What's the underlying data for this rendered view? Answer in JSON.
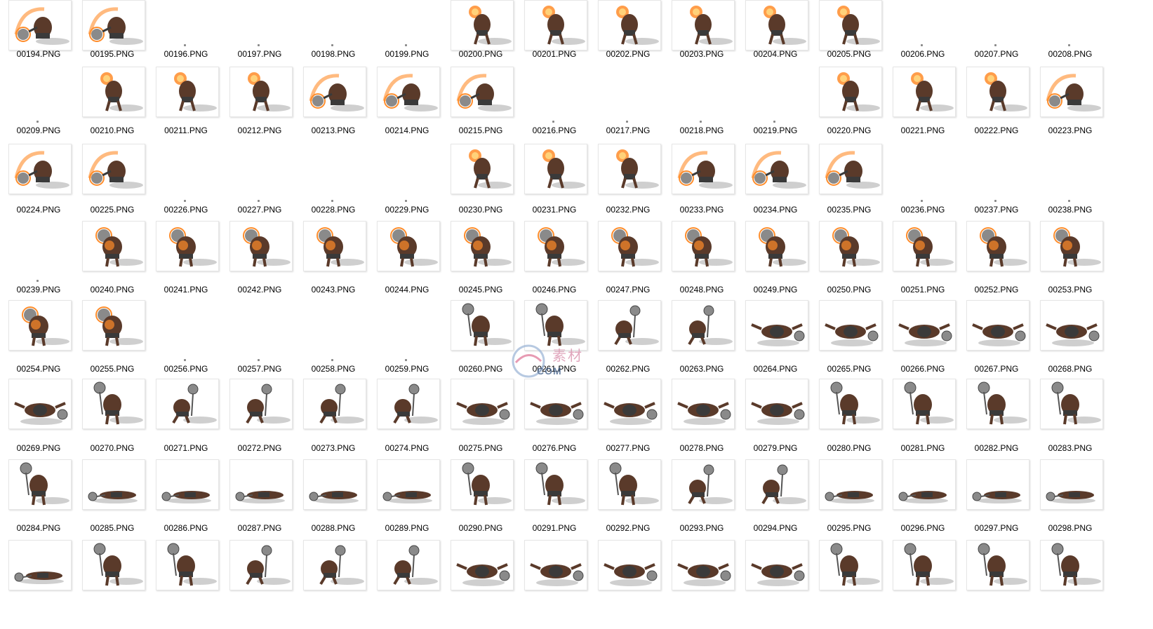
{
  "explorer": {
    "view": "large-icons",
    "columns": 15,
    "rows": [
      {
        "files": [
          {
            "name": "00194.PNG",
            "sprite": "fire-mace-swing"
          },
          {
            "name": "00195.PNG",
            "sprite": "fire-mace-swing"
          },
          {
            "name": "00196.PNG",
            "sprite": "empty"
          },
          {
            "name": "00197.PNG",
            "sprite": "empty"
          },
          {
            "name": "00198.PNG",
            "sprite": "empty"
          },
          {
            "name": "00199.PNG",
            "sprite": "empty"
          },
          {
            "name": "00200.PNG",
            "sprite": "fire-mace-raise"
          },
          {
            "name": "00201.PNG",
            "sprite": "fire-mace-raise"
          },
          {
            "name": "00202.PNG",
            "sprite": "fire-mace-raise"
          },
          {
            "name": "00203.PNG",
            "sprite": "fire-mace-raise"
          },
          {
            "name": "00204.PNG",
            "sprite": "fire-mace-raise"
          },
          {
            "name": "00205.PNG",
            "sprite": "fire-mace-raise"
          },
          {
            "name": "00206.PNG",
            "sprite": "empty"
          },
          {
            "name": "00207.PNG",
            "sprite": "empty"
          },
          {
            "name": "00208.PNG",
            "sprite": "empty"
          }
        ]
      },
      {
        "files": [
          {
            "name": "00209.PNG",
            "sprite": "empty"
          },
          {
            "name": "00210.PNG",
            "sprite": "fire-mace-raise"
          },
          {
            "name": "00211.PNG",
            "sprite": "fire-mace-raise"
          },
          {
            "name": "00212.PNG",
            "sprite": "fire-mace-raise"
          },
          {
            "name": "00213.PNG",
            "sprite": "fire-mace-swing"
          },
          {
            "name": "00214.PNG",
            "sprite": "fire-mace-swing"
          },
          {
            "name": "00215.PNG",
            "sprite": "fire-mace-swing"
          },
          {
            "name": "00216.PNG",
            "sprite": "empty"
          },
          {
            "name": "00217.PNG",
            "sprite": "empty"
          },
          {
            "name": "00218.PNG",
            "sprite": "empty"
          },
          {
            "name": "00219.PNG",
            "sprite": "empty"
          },
          {
            "name": "00220.PNG",
            "sprite": "fire-mace-raise"
          },
          {
            "name": "00221.PNG",
            "sprite": "fire-mace-raise"
          },
          {
            "name": "00222.PNG",
            "sprite": "fire-mace-raise"
          },
          {
            "name": "00223.PNG",
            "sprite": "fire-mace-swing"
          }
        ]
      },
      {
        "files": [
          {
            "name": "00224.PNG",
            "sprite": "fire-mace-swing"
          },
          {
            "name": "00225.PNG",
            "sprite": "fire-mace-swing"
          },
          {
            "name": "00226.PNG",
            "sprite": "empty"
          },
          {
            "name": "00227.PNG",
            "sprite": "empty"
          },
          {
            "name": "00228.PNG",
            "sprite": "empty"
          },
          {
            "name": "00229.PNG",
            "sprite": "empty"
          },
          {
            "name": "00230.PNG",
            "sprite": "fire-mace-raise"
          },
          {
            "name": "00231.PNG",
            "sprite": "fire-mace-raise"
          },
          {
            "name": "00232.PNG",
            "sprite": "fire-mace-raise"
          },
          {
            "name": "00233.PNG",
            "sprite": "fire-mace-swing"
          },
          {
            "name": "00234.PNG",
            "sprite": "fire-mace-swing"
          },
          {
            "name": "00235.PNG",
            "sprite": "fire-mace-swing"
          },
          {
            "name": "00236.PNG",
            "sprite": "empty"
          },
          {
            "name": "00237.PNG",
            "sprite": "empty"
          },
          {
            "name": "00238.PNG",
            "sprite": "empty"
          }
        ]
      },
      {
        "files": [
          {
            "name": "00239.PNG",
            "sprite": "empty"
          },
          {
            "name": "00240.PNG",
            "sprite": "fire-mace-hold"
          },
          {
            "name": "00241.PNG",
            "sprite": "fire-mace-hold"
          },
          {
            "name": "00242.PNG",
            "sprite": "fire-mace-hold"
          },
          {
            "name": "00243.PNG",
            "sprite": "fire-mace-hold"
          },
          {
            "name": "00244.PNG",
            "sprite": "fire-mace-hold"
          },
          {
            "name": "00245.PNG",
            "sprite": "fire-mace-hold"
          },
          {
            "name": "00246.PNG",
            "sprite": "fire-mace-hold"
          },
          {
            "name": "00247.PNG",
            "sprite": "fire-mace-hold"
          },
          {
            "name": "00248.PNG",
            "sprite": "fire-mace-hold"
          },
          {
            "name": "00249.PNG",
            "sprite": "fire-mace-hold"
          },
          {
            "name": "00250.PNG",
            "sprite": "fire-mace-hold"
          },
          {
            "name": "00251.PNG",
            "sprite": "fire-mace-hold"
          },
          {
            "name": "00252.PNG",
            "sprite": "fire-mace-hold"
          },
          {
            "name": "00253.PNG",
            "sprite": "fire-mace-hold"
          }
        ]
      },
      {
        "files": [
          {
            "name": "00254.PNG",
            "sprite": "fire-mace-hold"
          },
          {
            "name": "00255.PNG",
            "sprite": "fire-mace-hold"
          },
          {
            "name": "00256.PNG",
            "sprite": "empty"
          },
          {
            "name": "00257.PNG",
            "sprite": "empty"
          },
          {
            "name": "00258.PNG",
            "sprite": "empty"
          },
          {
            "name": "00259.PNG",
            "sprite": "empty"
          },
          {
            "name": "00260.PNG",
            "sprite": "mace-stand"
          },
          {
            "name": "00261.PNG",
            "sprite": "mace-stand"
          },
          {
            "name": "00262.PNG",
            "sprite": "mace-walk"
          },
          {
            "name": "00263.PNG",
            "sprite": "mace-walk"
          },
          {
            "name": "00264.PNG",
            "sprite": "mace-fall"
          },
          {
            "name": "00265.PNG",
            "sprite": "mace-fall"
          },
          {
            "name": "00266.PNG",
            "sprite": "mace-fall"
          },
          {
            "name": "00267.PNG",
            "sprite": "mace-fall"
          },
          {
            "name": "00268.PNG",
            "sprite": "mace-fall"
          }
        ]
      },
      {
        "files": [
          {
            "name": "00269.PNG",
            "sprite": "mace-fall"
          },
          {
            "name": "00270.PNG",
            "sprite": "mace-stand"
          },
          {
            "name": "00271.PNG",
            "sprite": "mace-walk"
          },
          {
            "name": "00272.PNG",
            "sprite": "mace-walk"
          },
          {
            "name": "00273.PNG",
            "sprite": "mace-walk"
          },
          {
            "name": "00274.PNG",
            "sprite": "mace-walk"
          },
          {
            "name": "00275.PNG",
            "sprite": "mace-fall"
          },
          {
            "name": "00276.PNG",
            "sprite": "mace-fall"
          },
          {
            "name": "00277.PNG",
            "sprite": "mace-fall"
          },
          {
            "name": "00278.PNG",
            "sprite": "mace-fall"
          },
          {
            "name": "00279.PNG",
            "sprite": "mace-fall"
          },
          {
            "name": "00280.PNG",
            "sprite": "mace-stand"
          },
          {
            "name": "00281.PNG",
            "sprite": "mace-stand"
          },
          {
            "name": "00282.PNG",
            "sprite": "mace-stand"
          },
          {
            "name": "00283.PNG",
            "sprite": "mace-stand"
          }
        ]
      },
      {
        "files": [
          {
            "name": "00284.PNG",
            "sprite": "mace-stand"
          },
          {
            "name": "00285.PNG",
            "sprite": "mace-lying"
          },
          {
            "name": "00286.PNG",
            "sprite": "mace-lying"
          },
          {
            "name": "00287.PNG",
            "sprite": "mace-lying"
          },
          {
            "name": "00288.PNG",
            "sprite": "mace-lying"
          },
          {
            "name": "00289.PNG",
            "sprite": "mace-lying"
          },
          {
            "name": "00290.PNG",
            "sprite": "mace-stand"
          },
          {
            "name": "00291.PNG",
            "sprite": "mace-stand"
          },
          {
            "name": "00292.PNG",
            "sprite": "mace-stand"
          },
          {
            "name": "00293.PNG",
            "sprite": "mace-walk"
          },
          {
            "name": "00294.PNG",
            "sprite": "mace-walk"
          },
          {
            "name": "00295.PNG",
            "sprite": "mace-lying"
          },
          {
            "name": "00296.PNG",
            "sprite": "mace-lying"
          },
          {
            "name": "00297.PNG",
            "sprite": "mace-lying"
          },
          {
            "name": "00298.PNG",
            "sprite": "mace-lying"
          }
        ]
      },
      {
        "files": [
          {
            "name": "",
            "sprite": "mace-lying"
          },
          {
            "name": "",
            "sprite": "mace-stand"
          },
          {
            "name": "",
            "sprite": "mace-stand"
          },
          {
            "name": "",
            "sprite": "mace-walk"
          },
          {
            "name": "",
            "sprite": "mace-walk"
          },
          {
            "name": "",
            "sprite": "mace-walk"
          },
          {
            "name": "",
            "sprite": "mace-fall"
          },
          {
            "name": "",
            "sprite": "mace-fall"
          },
          {
            "name": "",
            "sprite": "mace-fall"
          },
          {
            "name": "",
            "sprite": "mace-fall"
          },
          {
            "name": "",
            "sprite": "mace-fall"
          },
          {
            "name": "",
            "sprite": "mace-stand"
          },
          {
            "name": "",
            "sprite": "mace-stand"
          },
          {
            "name": "",
            "sprite": "mace-stand"
          },
          {
            "name": "",
            "sprite": "mace-stand"
          }
        ]
      }
    ]
  },
  "watermark": {
    "text": "素材",
    "url": "COM"
  },
  "colors": {
    "label": "#000000",
    "background": "#ffffff",
    "skin": "#5a3a2a",
    "armor": "#3a3a3a",
    "metal": "#8a8a8a",
    "fire": "#ff8c2a",
    "shadow": "#cfcfcf"
  }
}
